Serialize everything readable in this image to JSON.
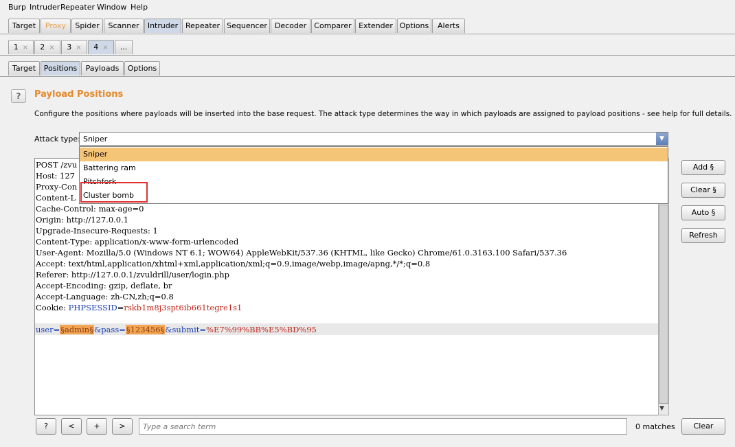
{
  "menu": [
    "Burp",
    "Intruder",
    "Repeater",
    "Window",
    "Help"
  ],
  "main_tabs": [
    "Target",
    "Proxy",
    "Spider",
    "Scanner",
    "Intruder",
    "Repeater",
    "Sequencer",
    "Decoder",
    "Comparer",
    "Extender",
    "Options",
    "Alerts"
  ],
  "main_tabs_active": "Intruder",
  "instance_tabs": [
    "1",
    "2",
    "3",
    "4",
    "..."
  ],
  "instance_close": "×",
  "instance_active": "4",
  "sub_tabs": [
    "Target",
    "Positions",
    "Payloads",
    "Options"
  ],
  "sub_tabs_active": "Positions",
  "section": {
    "help_label": "?",
    "title": "Payload Positions",
    "description": "Configure the positions where payloads will be inserted into the base request. The attack type determines the way in which payloads are assigned to payload positions - see help for full details."
  },
  "attack_type": {
    "label": "Attack type:",
    "value": "Sniper",
    "options": [
      "Sniper",
      "Battering ram",
      "Pitchfork",
      "Cluster bomb"
    ],
    "highlighted_option": "Sniper",
    "annotated_option": "Cluster bomb"
  },
  "request": {
    "lines": [
      "POST /zvu",
      "Host: 127",
      "Proxy-Con",
      "Content-L",
      "Cache-Control: max-age=0",
      "Origin: http://127.0.0.1",
      "Upgrade-Insecure-Requests: 1",
      "Content-Type: application/x-www-form-urlencoded",
      "User-Agent: Mozilla/5.0 (Windows NT 6.1; WOW64) AppleWebKit/537.36 (KHTML, like Gecko) Chrome/61.0.3163.100 Safari/537.36",
      "Accept: text/html,application/xhtml+xml,application/xml;q=0.9,image/webp,image/apng,*/*;q=0.8",
      "Referer: http://127.0.0.1/zvuldrill/user/login.php",
      "Accept-Encoding: gzip, deflate, br",
      "Accept-Language: zh-CN,zh;q=0.8"
    ],
    "cookie": {
      "prefix": "Cookie: ",
      "name": "PHPSESSID",
      "eq": "=",
      "value": "rskb1m8j3spt6ib661tegre1s1"
    },
    "body": {
      "user_key": "user=",
      "user_val": "§admin§",
      "pass_key": "&pass=",
      "pass_val": "§123456§",
      "submit_key": "&submit=",
      "submit_val": "%E7%99%BB%E5%BD%95"
    }
  },
  "buttons": {
    "add": "Add §",
    "clear": "Clear §",
    "auto": "Auto §",
    "refresh": "Refresh"
  },
  "bottom": {
    "help": "?",
    "prev": "<",
    "plus": "+",
    "next": ">",
    "search_placeholder": "Type a search term",
    "matches": "0 matches",
    "clear": "Clear"
  },
  "colors": {
    "accent": "#e58a2b",
    "payload_marker": "#f3a552",
    "annotation": "#e03030",
    "dropdown_selected": "#f5c577"
  }
}
